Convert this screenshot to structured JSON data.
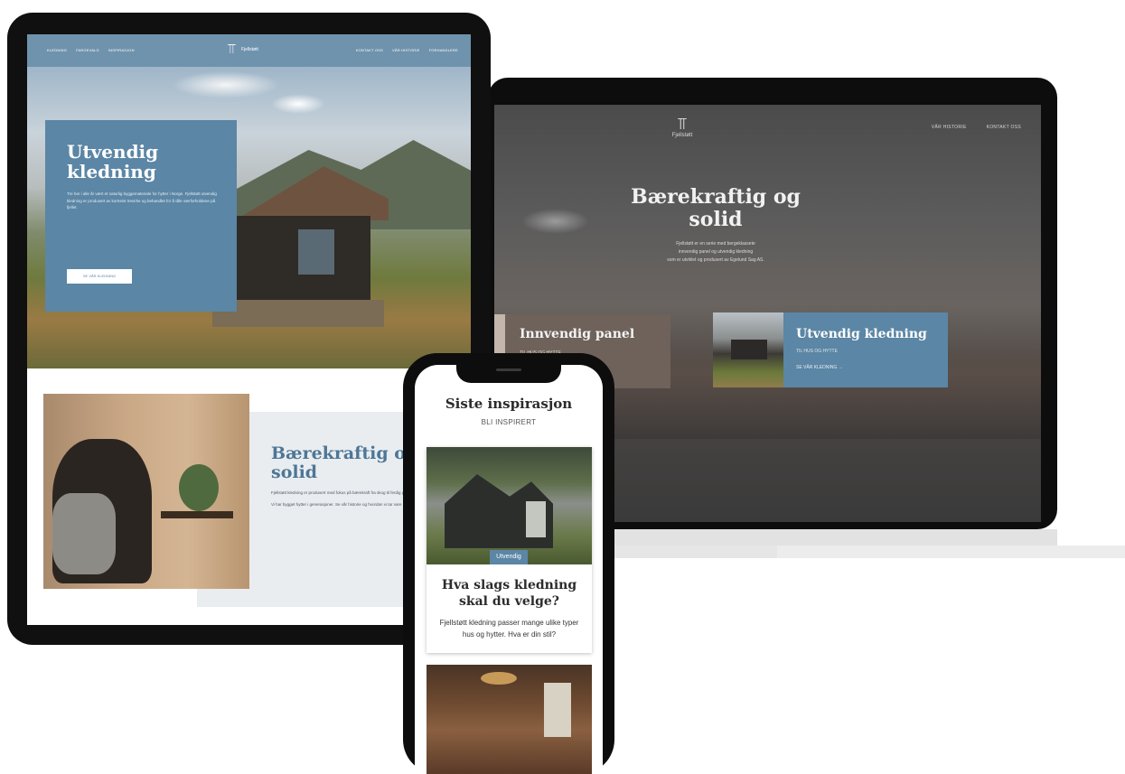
{
  "laptop": {
    "logo_text": "Fjellstøtt",
    "nav": [
      "VÅR HISTORIE",
      "KONTAKT OSS"
    ],
    "hero_title": "Bærekraftig og solid",
    "hero_sub_1": "Fjellstøtt er en serie med bergeklassete",
    "hero_sub_2": "innvendig panel og utvendig kledning",
    "hero_sub_3": "som er utviklet og produsert av Egelund Sag AS.",
    "card_panel": {
      "title": "Innvendig panel",
      "sub": "TIL HUS OG HYTTE"
    },
    "card_kledning": {
      "title": "Utvendig kledning",
      "sub": "TIL HUS OG HYTTE",
      "link": "SE VÅR KLEDNING →"
    }
  },
  "tablet": {
    "logo_text": "Fjellstøtt",
    "nav_left": [
      "KLEDNING",
      "FARGEVALG",
      "INSPIRASJON"
    ],
    "nav_right": [
      "KONTAKT OSS",
      "VÅR HISTORIE",
      "FORHANDLERE"
    ],
    "overlay_title": "Utvendig kledning",
    "overlay_text": "Tre har i alle år vært et naturlig byggemateriale for hytter i Norge. Fjellstøtt utvendig kledning er produsert av kortreist trevirke og behandlet for å tåle værforholdene på fjellet.",
    "overlay_button": "SE VÅR KLEDNING",
    "lower_title": "Bærekraftig og solid",
    "lower_text_1": "Fjellstøtt kledning er produsert med fokus på bærekraft fra skog til ferdig produkt.",
    "lower_text_2": "Vi har bygget hytter i generasjoner. Se vår historie og hvordan vi tar vare på naturen rundt oss."
  },
  "phone": {
    "title": "Siste inspirasjon",
    "subtitle": "BLI INSPIRERT",
    "card": {
      "tag": "Utvendig",
      "title": "Hva slags kledning skal du velge?",
      "text": "Fjellstøtt kledning passer mange ulike typer hus og hytter. Hva er din stil?"
    }
  }
}
